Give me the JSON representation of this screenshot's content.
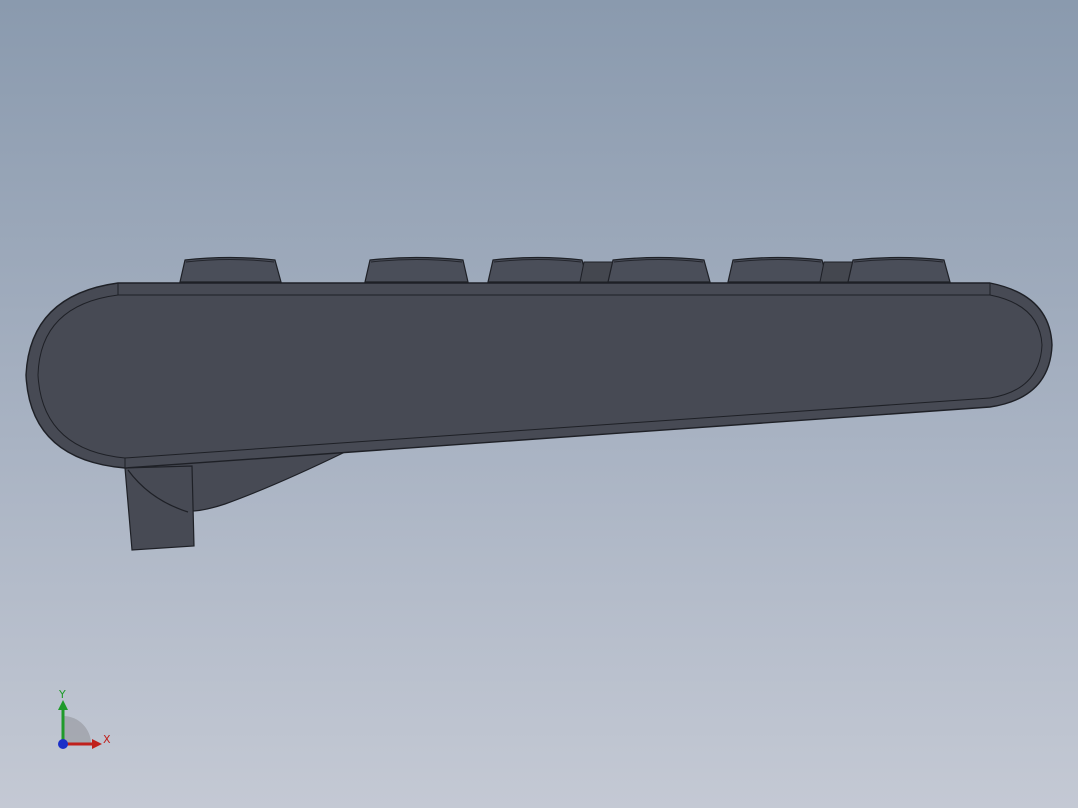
{
  "viewport": {
    "model": "keyboard-side-view",
    "background": {
      "top": "#8a9aae",
      "bottom": "#c4c9d4"
    },
    "body_color": "#474a54",
    "edge_color": "#1e2026"
  },
  "triad": {
    "x_label": "X",
    "y_label": "Y",
    "x_color": "#c0201c",
    "y_color": "#1f9a2a",
    "z_color": "#1a2fc8"
  }
}
